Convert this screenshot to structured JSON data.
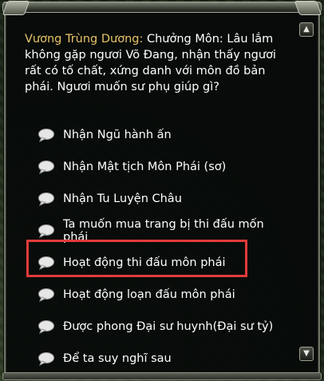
{
  "dialog": {
    "speaker": "Vương Trùng Dương:",
    "message": "Chưởng Môn: Lâu lắm không gặp ngươi Võ Đang, nhận thấy ngươi rất có tố chất, xứng danh với môn đồ bản phái. Ngươi muốn sư phụ giúp gì?",
    "scroll_up_icon": "▲",
    "scroll_down_icon": "▼"
  },
  "options": [
    {
      "label": "Nhận Ngũ hành ấn"
    },
    {
      "label": "Nhận Mật tịch Môn Phái (sơ)"
    },
    {
      "label": "Nhận Tu Luyện Châu"
    },
    {
      "label": "Ta muốn mua trang bị thi đấu mốn phái"
    },
    {
      "label": "Hoạt động thi đấu môn phái"
    },
    {
      "label": "Hoạt động loạn đấu môn phái"
    },
    {
      "label": "Được phong Đại sư huynh(Đại sư tỷ)"
    },
    {
      "label": "Để ta suy nghĩ sau"
    }
  ],
  "highlight_color": "#e23b3b",
  "speaker_color": "#e8c46a"
}
